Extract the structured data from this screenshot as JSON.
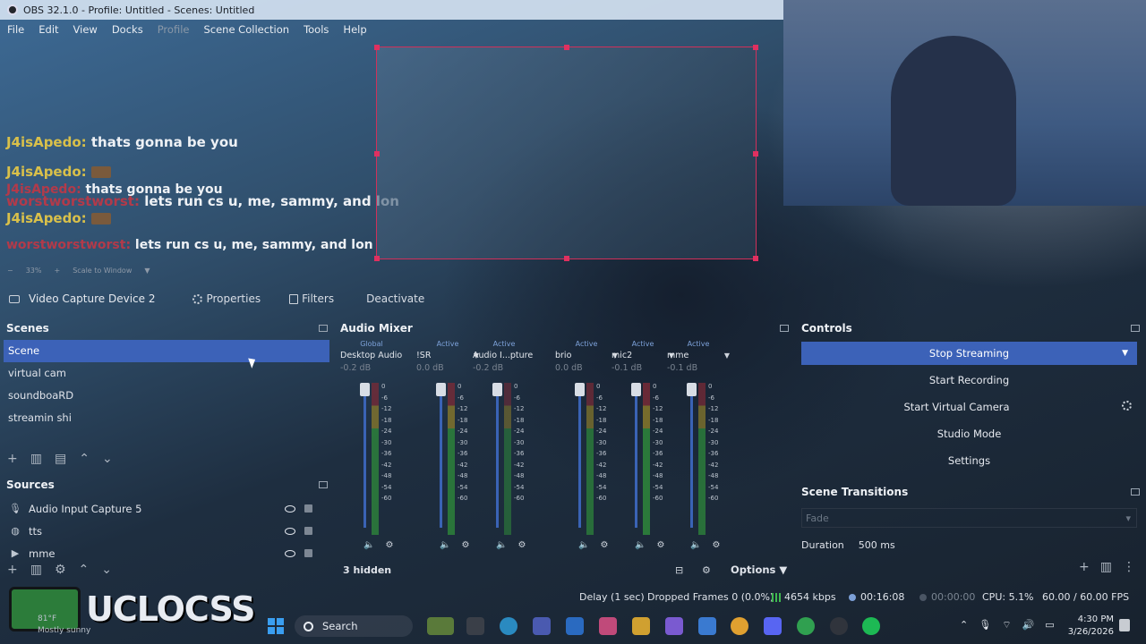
{
  "window": {
    "title": "OBS 32.1.0 - Profile: Untitled - Scenes: Untitled"
  },
  "menu": [
    "File",
    "Edit",
    "View",
    "Docks",
    "Profile",
    "Scene Collection",
    "Tools",
    "Help"
  ],
  "chat": [
    {
      "user": "J4isApedo:",
      "msg": "thats gonna be you"
    },
    {
      "user": "J4isApedo:",
      "msg": ""
    },
    {
      "user": "J4isApedo:",
      "msg": "thats gonna be you"
    },
    {
      "user": "worstworstworst:",
      "msg": "lets run cs u, me, sammy, and lon"
    },
    {
      "user": "J4isApedo:",
      "msg": ""
    },
    {
      "user": "worstworstworst:",
      "msg": "lets run cs u, me, sammy, and lon"
    }
  ],
  "preview": {
    "zoom": "33%",
    "scale_mode": "Scale to Window"
  },
  "source_toolbar": {
    "source_name": "Video Capture Device 2",
    "properties": "Properties",
    "filters": "Filters",
    "deactivate": "Deactivate"
  },
  "scenes": {
    "title": "Scenes",
    "items": [
      "Scene",
      "virtual cam",
      "soundboaRD",
      "streamin shi"
    ],
    "selected": "Scene"
  },
  "sources": {
    "title": "Sources",
    "items": [
      {
        "name": "Audio Input Capture 5",
        "icon": "microphone-icon"
      },
      {
        "name": "tts",
        "icon": "globe-icon"
      },
      {
        "name": "mme",
        "icon": "play-icon"
      }
    ]
  },
  "mixer": {
    "title": "Audio Mixer",
    "channels": [
      {
        "status": "Global",
        "name": "Desktop Audio",
        "db": "-0.2 dB",
        "level": 0.7
      },
      {
        "status": "Active",
        "name": "!SR",
        "db": "0.0 dB",
        "level": 0.75
      },
      {
        "status": "Active",
        "name": "Audio I...pture 5",
        "db": "-0.2 dB",
        "level": 0.3
      },
      {
        "status": "Active",
        "name": "brio",
        "db": "0.0 dB",
        "level": 0.6
      },
      {
        "status": "Active",
        "name": "mic2",
        "db": "-0.1 dB",
        "level": 0.85
      },
      {
        "status": "Active",
        "name": "mme",
        "db": "-0.1 dB",
        "level": 0.65
      }
    ],
    "scale": [
      "0",
      "-6",
      "-12",
      "-18",
      "-24",
      "-30",
      "-36",
      "-42",
      "-48",
      "-54",
      "-60"
    ],
    "hidden": "3 hidden",
    "options": "Options"
  },
  "controls": {
    "title": "Controls",
    "buttons": [
      "Stop Streaming",
      "Start Recording",
      "Start Virtual Camera",
      "Studio Mode",
      "Settings"
    ]
  },
  "transitions": {
    "title": "Scene Transitions",
    "selected": "Fade",
    "duration_label": "Duration",
    "duration_value": "500 ms"
  },
  "status": {
    "delay": "Delay (1 sec)",
    "dropped": "Dropped Frames 0 (0.0%)",
    "bitrate": "4654 kbps",
    "stream_time": "00:16:08",
    "record_time": "00:00:00",
    "cpu": "CPU: 5.1%",
    "fps": "60.00 / 60.00 FPS"
  },
  "taskbar": {
    "search": "Search",
    "time": "4:30 PM",
    "date": "3/26/2026",
    "weather_temp": "81°F",
    "weather_desc": "Mostly sunny"
  },
  "overlay_logo": "UCLOCSS",
  "colors": {
    "accent": "#3c62b8",
    "preview_border": "#d0305a"
  }
}
